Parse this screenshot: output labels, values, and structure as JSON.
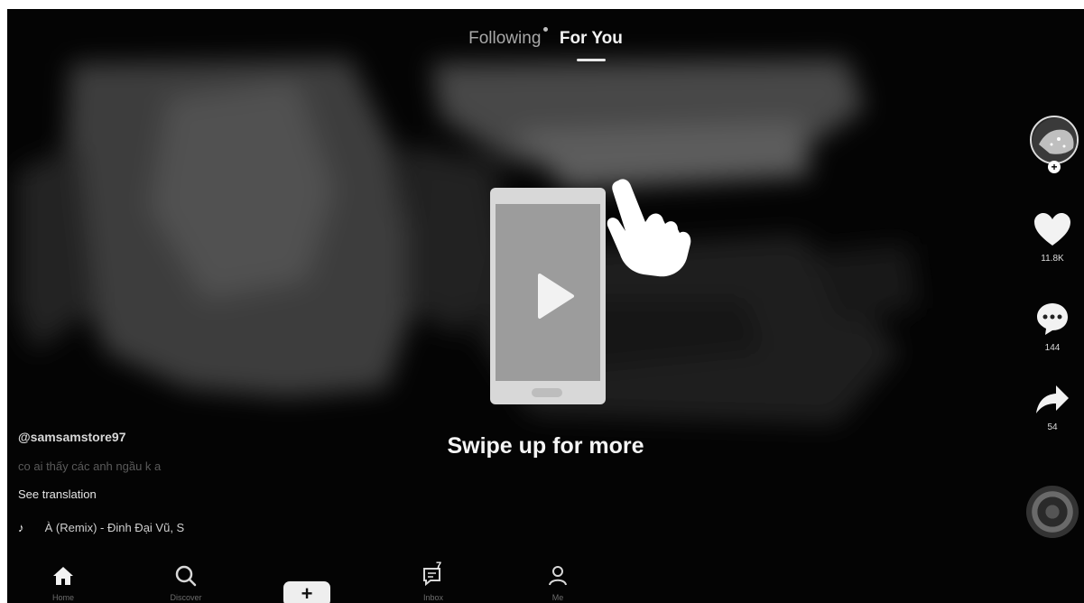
{
  "top_tabs": {
    "following": "Following",
    "for_you": "For You"
  },
  "overlay": {
    "swipe_text": "Swipe up for more",
    "phone_icon": "phone-icon",
    "play_icon": "play-icon",
    "hand_icon": "hand-pointer-icon"
  },
  "rail": {
    "likes": "11.8K",
    "comments": "144",
    "shares": "54",
    "avatar_icon": "avatar",
    "plus": "+"
  },
  "post": {
    "username": "@samsamstore97",
    "caption": "co ai thấy các anh ngầu k a",
    "see_translation": "See translation",
    "music": "À (Remix) - Đinh Đại Vũ, S"
  },
  "nav": {
    "home": "Home",
    "discover": "Discover",
    "create": "+",
    "inbox": "Inbox",
    "inbox_count": "7",
    "me": "Me"
  },
  "colors": {
    "background": "#050505",
    "accent_white": "#f5f5f5",
    "muted_text": "#5a5a5a"
  }
}
